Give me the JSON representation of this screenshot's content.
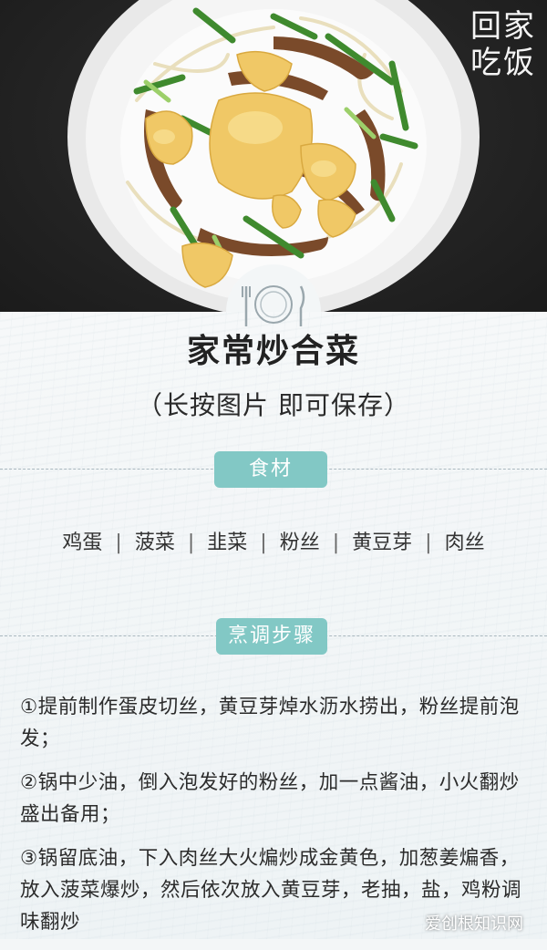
{
  "brand": {
    "line1": "回家",
    "line2": "吃饭"
  },
  "header": {
    "title": "家常炒合菜",
    "subtitle": "（长按图片  即可保存）"
  },
  "sections": {
    "ingredients_label": "食材",
    "steps_label": "烹调步骤"
  },
  "ingredients": [
    "鸡蛋",
    "菠菜",
    "韭菜",
    "粉丝",
    "黄豆芽",
    "肉丝"
  ],
  "ingredient_separator": "|",
  "steps": [
    "①提前制作蛋皮切丝，黄豆芽焯水沥水捞出，粉丝提前泡发；",
    "②锅中少油，倒入泡发好的粉丝，加一点酱油，小火翻炒盛出备用；",
    "③锅留底油，下入肉丝大火煸炒成金黄色，加葱姜煸香，放入菠菜爆炒，然后依次放入黄豆芽，老抽，盐，鸡粉调味翻炒"
  ],
  "watermark": "爱创根知识网",
  "colors": {
    "accent": "#82c8c5",
    "background": "#f3f6f7",
    "photo_bg": "#242424"
  }
}
